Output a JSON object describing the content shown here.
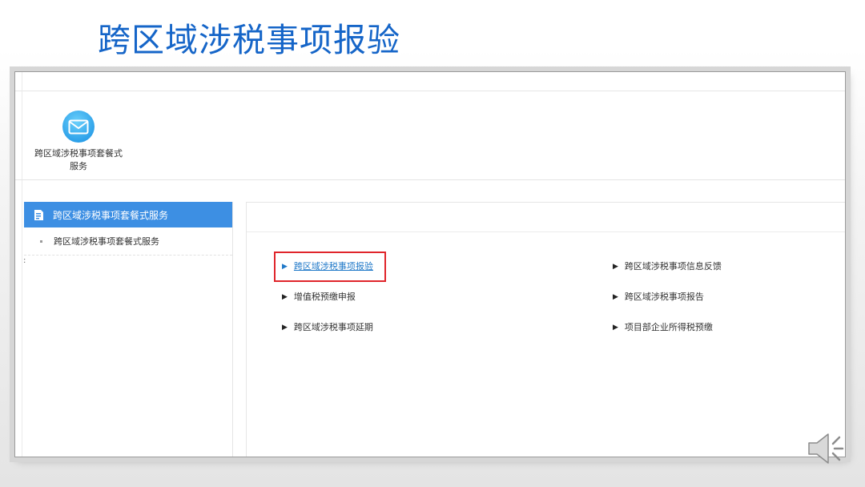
{
  "slide": {
    "title": "跨区域涉税事项报验"
  },
  "service_tile": {
    "icon": "mail-icon",
    "label_line1": "跨区域涉税事项套餐式",
    "label_line2": "服务"
  },
  "sidebar": {
    "header_icon": "document-icon",
    "header_label": "跨区域涉税事项套餐式服务",
    "items": [
      {
        "label": "跨区域涉税事项套餐式服务"
      }
    ]
  },
  "links": {
    "left": [
      {
        "label": "跨区域涉税事项报验",
        "active": true
      },
      {
        "label": "增值税预缴申报"
      },
      {
        "label": "跨区域涉税事项延期"
      }
    ],
    "right": [
      {
        "label": "跨区域涉税事项信息反馈"
      },
      {
        "label": "跨区域涉税事项报告"
      },
      {
        "label": "项目部企业所得税预缴"
      }
    ]
  },
  "colors": {
    "title": "#1565c8",
    "sidebar_header": "#3d8fe3",
    "active_link": "#1f78c8",
    "highlight": "#e0252b"
  },
  "overlay_icon": "speaker-icon"
}
